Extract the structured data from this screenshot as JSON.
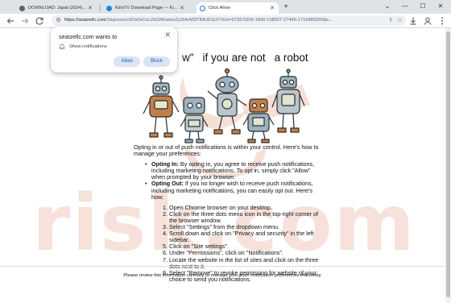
{
  "tabs": [
    {
      "title": "DOWNLOAD: Japal (2024) [No C...",
      "active": false,
      "favicon_color": "#5f6368"
    },
    {
      "title": "KirisTV Download Page — Kiris...",
      "active": false,
      "favicon_color": "#1e88e5"
    },
    {
      "title": "Click Allow",
      "active": true,
      "favicon_color": "#1a73e8"
    }
  ],
  "window_controls": {
    "minimize": "⌄",
    "restore": "—",
    "maximize": "☐",
    "close": "✕"
  },
  "toolbar": {
    "url_host": "https://seatzellc.com",
    "url_path": "/1tujvosnzc0Ox0xCnLZkGNFadooZy3t4cMl3T80UESU/?clck=9733-5309-1600-158927-27445-1716985260&s...",
    "icons": {
      "back": "arrow-left-icon",
      "forward": "arrow-right-icon",
      "reload": "reload-icon",
      "download": "download-icon",
      "profile": "profile-icon",
      "menu": "menu-dots-icon"
    }
  },
  "popup": {
    "title": "seatzellc.com wants to",
    "message": "Show notifications",
    "allow": "Allow",
    "block": "Block"
  },
  "headline": {
    "part1": "w\"",
    "part2": "if you are not",
    "part3": "a robot"
  },
  "body": {
    "intro": "Opting in or out of push notifications is within your control. Here's how to manage your preferences:",
    "opt_in_label": "Opting In:",
    "opt_in_text": " By opting in, you agree to receive push notifications, including marketing notifications. To opt in, simply click \"Allow\" when prompted by your browser.",
    "opt_out_label": "Opting Out:",
    "opt_out_text": " If you no longer wish to receive push notifications, including marketing notifications, you can easily opt out. Here's how:",
    "steps": [
      "Open Chrome browser on your desktop.",
      "Click on the three dots menu icon in the top-right corner of the browser window.",
      "Select \"Settings\" from the dropdown menu.",
      "Scroll down and click on \"Privacy and security\" in the left sidebar.",
      "Click on \"Site settings\".",
      "Under \"Permissions\", click on \"Notifications\".",
      "Locate the website in the list of sites and click on the three dots next to it.",
      "Select \"Remove\" to revoke permission for website of your choice to send you notifications."
    ]
  },
  "footer": "Please review this information carefully to manage your push notification preferences effectively.",
  "colors": {
    "accent": "#1a73e8",
    "tabstrip": "#dfe3e7",
    "button_bg": "#dbe4f5",
    "button_text": "#1a56b8",
    "watermark": "#f3d9cf"
  }
}
